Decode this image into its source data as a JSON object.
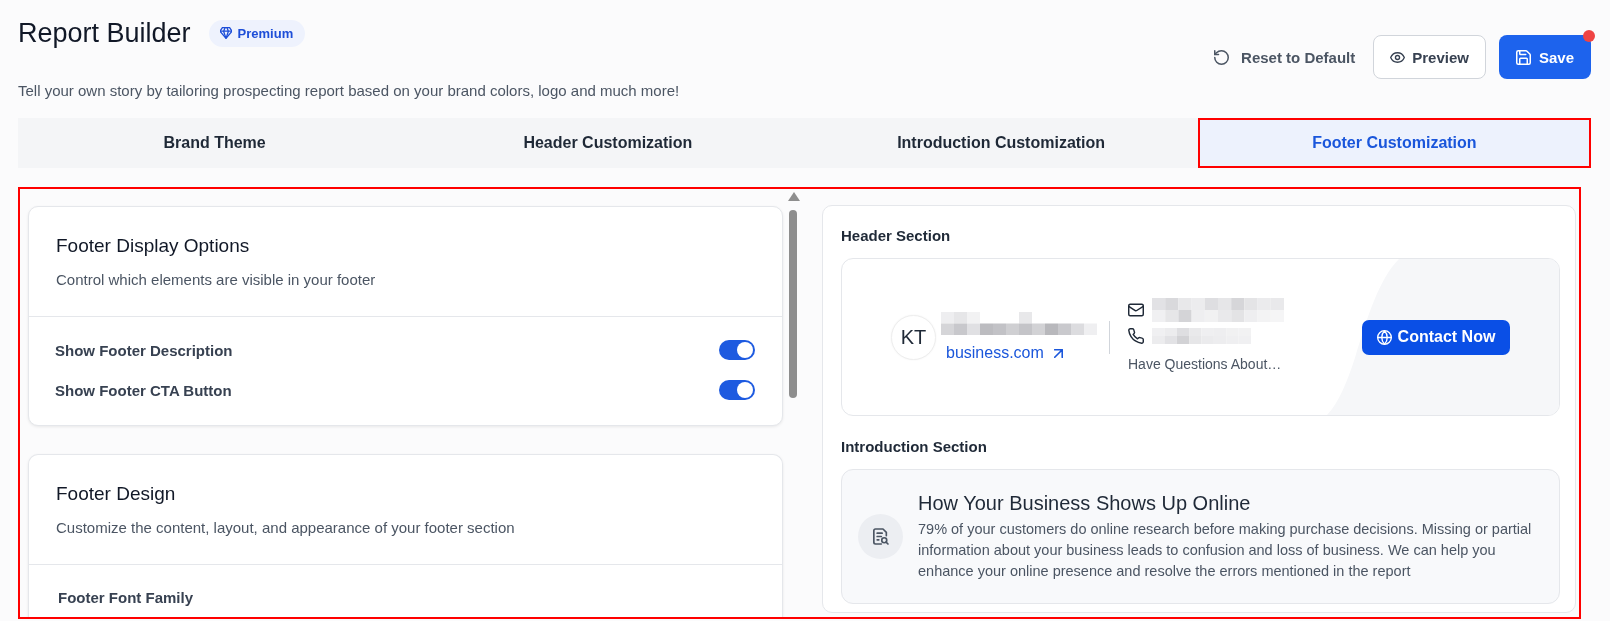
{
  "header": {
    "title": "Report Builder",
    "badge": "Premium",
    "subtitle": "Tell your own story by tailoring prospecting report based on your brand colors, logo and much more!"
  },
  "actions": [
    {
      "kind": "reset",
      "label": "Reset to Default"
    },
    {
      "kind": "preview",
      "label": "Preview"
    },
    {
      "kind": "save",
      "label": "Save",
      "notification": true
    }
  ],
  "tabs": [
    {
      "label": "Brand Theme",
      "selected": false
    },
    {
      "label": "Header Customization",
      "selected": false
    },
    {
      "label": "Introduction Customization",
      "selected": false
    },
    {
      "label": "Footer Customization",
      "selected": true
    }
  ],
  "settings": {
    "cards": [
      {
        "title": "Footer Display Options",
        "description": "Control which elements are visible in your footer",
        "rows": [
          {
            "kind": "toggle",
            "label": "Show Footer Description",
            "on": true
          },
          {
            "kind": "toggle",
            "label": "Show Footer CTA Button",
            "on": true
          }
        ]
      },
      {
        "title": "Footer Design",
        "description": "Customize the content, layout, and appearance of your footer section",
        "rows": [
          {
            "kind": "field",
            "label": "Footer Font Family"
          }
        ]
      }
    ]
  },
  "preview": {
    "header_section": {
      "label": "Header Section",
      "avatar": "KT",
      "link": "business.com",
      "tagline": "Have Questions About…",
      "button": "Contact Now"
    },
    "introduction_section": {
      "label": "Introduction Section",
      "title": "How Your Business Shows Up Online",
      "text": "79% of your customers do online research before making purchase decisions. Missing or partial information about your business leads to confusion and loss of business. We can help you enhance your online presence and resolve the errors mentioned in the report"
    }
  }
}
